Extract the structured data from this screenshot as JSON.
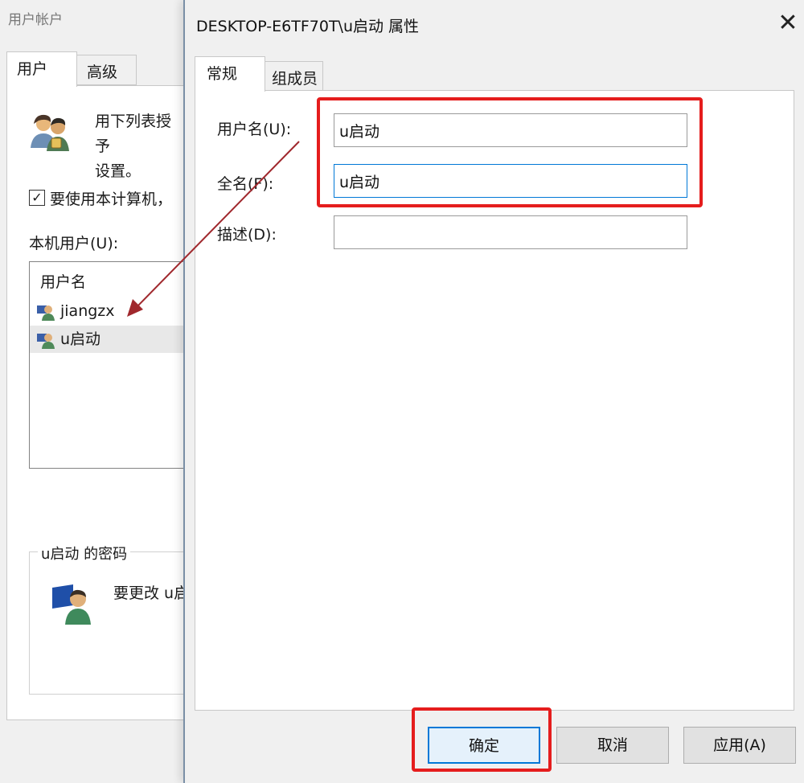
{
  "background_window": {
    "title": "用户帐户",
    "tabs": [
      {
        "label": "用户"
      },
      {
        "label": "高级"
      }
    ],
    "description": "用下列表授予\n设置。",
    "checkbox_label": "要使用本计算机，",
    "checkbox_checked": true,
    "local_users_label": "本机用户(U):",
    "list_header": "用户名",
    "users": [
      {
        "name": "jiangzx"
      },
      {
        "name": "u启动"
      }
    ],
    "password_group_title": "u启动 的密码",
    "password_text": "要更改 u启"
  },
  "dialog": {
    "title": "DESKTOP-E6TF70T\\u启动 属性",
    "close_glyph": "✕",
    "tabs": [
      {
        "label": "常规"
      },
      {
        "label": "组成员"
      }
    ],
    "fields": {
      "username_label": "用户名(U):",
      "username_value": "u启动",
      "fullname_label": "全名(F):",
      "fullname_value": "u启动",
      "description_label": "描述(D):",
      "description_value": ""
    },
    "buttons": {
      "ok": "确定",
      "cancel": "取消",
      "apply": "应用(A)"
    }
  },
  "annotation_colors": {
    "highlight_box": "#e51d1d",
    "arrow": "#a0282d"
  }
}
